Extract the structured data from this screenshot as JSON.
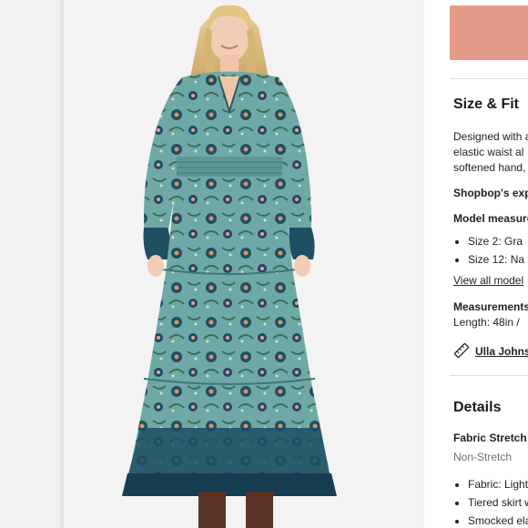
{
  "size_fit": {
    "heading": "Size & Fit",
    "desc_lines": [
      "Designed with a",
      "elastic waist al",
      "softened hand,"
    ],
    "shopbop_exp": "Shopbop's exp",
    "model_measure": "Model measure",
    "model_sizes": [
      "Size 2: Gra",
      "Size 12: Na"
    ],
    "view_all": "View all model",
    "measurements_label": "Measurements",
    "length": "Length: 48in / ",
    "brand_link": "Ulla Johns"
  },
  "details": {
    "heading": "Details",
    "fabric_stretch_label": "Fabric Stretch",
    "fabric_stretch_value": "Non-Stretch",
    "bullets": [
      "Fabric: Light",
      "Tiered skirt w",
      "Smocked ela"
    ]
  },
  "icons": {
    "ruler": "ruler-icon"
  },
  "colors": {
    "add_to_bag": "#e59a88",
    "dress_base": "#6fa9a6",
    "dress_dark": "#1f4f63"
  }
}
